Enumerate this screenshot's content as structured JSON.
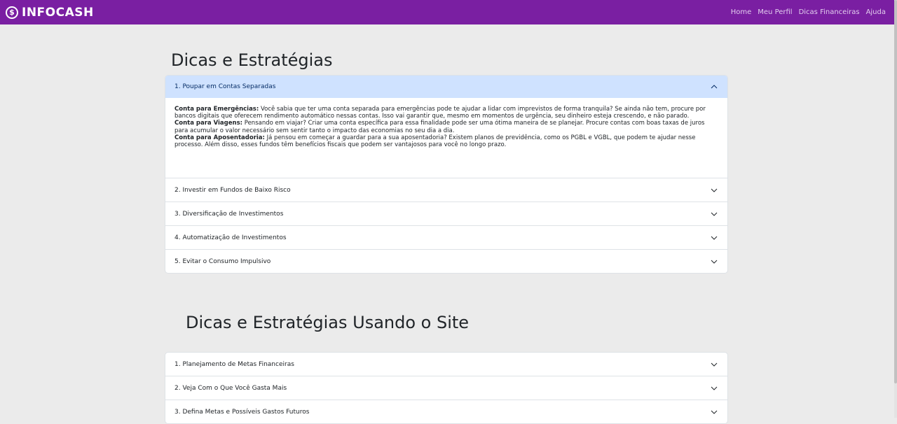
{
  "navbar": {
    "brand_icon": "$",
    "brand": "INFOCASH",
    "links": [
      "Home",
      "Meu Perfil",
      "Dicas Financeiras",
      "Ajuda"
    ]
  },
  "section1": {
    "title": "Dicas e Estratégias",
    "items": [
      {
        "label": "1. Poupar em Contas Separadas",
        "expanded": true
      },
      {
        "label": "2. Investir em Fundos de Baixo Risco"
      },
      {
        "label": "3. Diversificação de Investimentos"
      },
      {
        "label": "4. Automatização de Investimentos"
      },
      {
        "label": "5. Evitar o Consumo Impulsivo"
      }
    ],
    "body": [
      {
        "bold": "Conta para Emergências:",
        "text": " Você sabia que ter uma conta separada para emergências pode te ajudar a lidar com imprevistos de forma tranquila? Se ainda não tem, procure por bancos digitais que oferecem rendimento automático nessas contas. Isso vai garantir que, mesmo em momentos de urgência, seu dinheiro esteja crescendo, e não parado."
      },
      {
        "bold": "Conta para Viagens:",
        "text": " Pensando em viajar? Criar uma conta específica para essa finalidade pode ser uma ótima maneira de se planejar. Procure contas com boas taxas de juros para acumular o valor necessário sem sentir tanto o impacto das economias no seu dia a dia."
      },
      {
        "bold": "Conta para Aposentadoria:",
        "text": " Já pensou em começar a guardar para a sua aposentadoria? Existem planos de previdência, como os PGBL e VGBL, que podem te ajudar nesse processo. Além disso, esses fundos têm benefícios fiscais que podem ser vantajosos para você no longo prazo."
      }
    ]
  },
  "section2": {
    "title": "Dicas e Estratégias Usando o Site",
    "items": [
      {
        "label": "1. Planejamento de Metas Financeiras"
      },
      {
        "label": "2. Veja Com o Que Você Gasta Mais"
      },
      {
        "label": "3. Defina Metas e Possíveis Gastos Futuros"
      }
    ]
  },
  "colors": {
    "navbar": "#7a1fa2",
    "accent_open": "#cfe2ff",
    "background": "#ebebeb"
  }
}
